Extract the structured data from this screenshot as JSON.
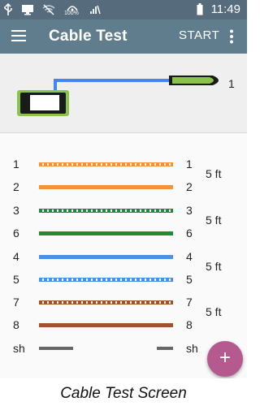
{
  "status_bar": {
    "time": "11:49",
    "signal_label": "100%",
    "icons": [
      "usb-icon",
      "monitor-icon",
      "wifi-off-icon",
      "signal-icon",
      "battery-icon"
    ]
  },
  "app_bar": {
    "title": "Cable Test",
    "start_label": "START",
    "menu_icon": "hamburger-icon",
    "overflow_icon": "more-vert-icon"
  },
  "diagram": {
    "remote_id": "1",
    "colors": {
      "device": "#8bc34a",
      "cable": "#4285f4"
    }
  },
  "wiremap": {
    "pairs": [
      {
        "length": "5 ft",
        "wires": [
          {
            "left": "1",
            "right": "1",
            "color": "#f39237",
            "striped": true
          },
          {
            "left": "2",
            "right": "2",
            "color": "#f39237",
            "striped": false
          }
        ]
      },
      {
        "length": "5 ft",
        "wires": [
          {
            "left": "3",
            "right": "3",
            "color": "#1e8c36",
            "striped": true
          },
          {
            "left": "6",
            "right": "6",
            "color": "#1e8c36",
            "striped": false
          }
        ]
      },
      {
        "length": "5 ft",
        "wires": [
          {
            "left": "4",
            "right": "4",
            "color": "#4d8fe6",
            "striped": false
          },
          {
            "left": "5",
            "right": "5",
            "color": "#4d8fe6",
            "striped": true
          }
        ]
      },
      {
        "length": "5 ft",
        "wires": [
          {
            "left": "7",
            "right": "7",
            "color": "#a0532a",
            "striped": true
          },
          {
            "left": "8",
            "right": "8",
            "color": "#a0532a",
            "striped": false
          }
        ]
      }
    ],
    "shield": {
      "left": "sh",
      "right": "sh",
      "color": "#666666"
    }
  },
  "fab": {
    "icon": "plus-icon",
    "label": "+",
    "color": "#b55a8f"
  },
  "caption": "Cable Test Screen"
}
